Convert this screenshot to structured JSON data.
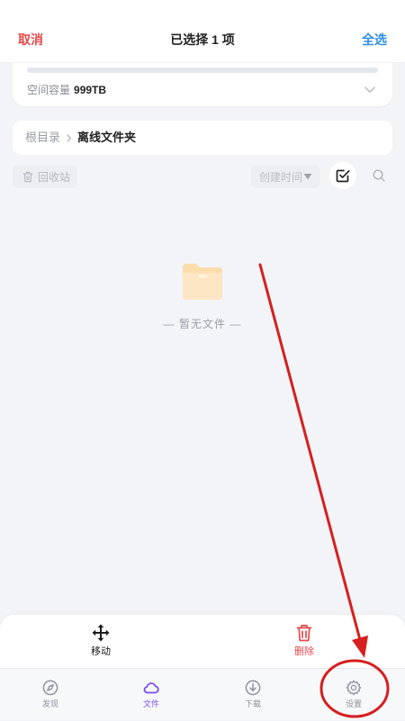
{
  "header": {
    "cancel_label": "取消",
    "title": "已选择 1 项",
    "select_all_label": "全选"
  },
  "storage": {
    "label": "空间容量",
    "capacity": "999TB",
    "used_fraction": 0,
    "expand_icon": "chevron-down-icon"
  },
  "breadcrumb": {
    "root": "根目录",
    "separator_icon": "chevron-right-icon",
    "current": "离线文件夹"
  },
  "toolbar": {
    "recycle_icon": "trash-icon",
    "recycle_label": "回收站",
    "sort_label": "创建时间",
    "sort_icon": "caret-down-icon",
    "select_icon": "check-square-icon",
    "search_icon": "search-icon"
  },
  "empty_state": {
    "icon": "folder-icon",
    "text": "— 暂无文件 —"
  },
  "actions": [
    {
      "label": "移动",
      "icon": "move-icon"
    },
    {
      "label": "删除",
      "icon": "trash-icon"
    }
  ],
  "tabs": [
    {
      "label": "发现",
      "icon": "compass-icon",
      "active": false
    },
    {
      "label": "文件",
      "icon": "cloud-icon",
      "active": true
    },
    {
      "label": "下载",
      "icon": "download-icon",
      "active": false
    },
    {
      "label": "设置",
      "icon": "gear-icon",
      "active": false
    }
  ],
  "colors": {
    "cancel": "#e6484a",
    "select_all": "#2f8fe6",
    "danger": "#e5484d",
    "active_tab": "#7d4cf2",
    "inactive_tab": "#8d929b",
    "annotation": "#d61f1f"
  }
}
